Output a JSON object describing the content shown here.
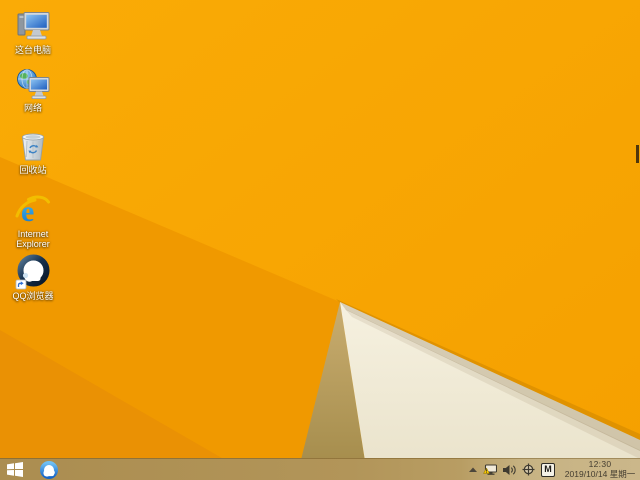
{
  "desktop": {
    "icons": [
      {
        "name": "this-pc",
        "label": "这台电脑"
      },
      {
        "name": "network",
        "label": "网络"
      },
      {
        "name": "recycle-bin",
        "label": "回收站"
      },
      {
        "name": "internet-explorer",
        "label": "Internet Explorer"
      },
      {
        "name": "qq-browser",
        "label": "QQ浏览器"
      }
    ]
  },
  "taskbar": {
    "pinned_apps": [
      {
        "name": "qq-browser"
      }
    ],
    "tray": {
      "icon_names": [
        "hidden-icons-arrow",
        "network-status",
        "volume",
        "crosshair",
        "ime-mode"
      ],
      "ime_letter": "M",
      "time": "12:30",
      "date": "2019/10/14 星期一"
    }
  },
  "colors": {
    "wallpaper_base": "#f8a601",
    "wallpaper_facet_mid": "#f09900",
    "wallpaper_facet_dark": "#ea9104",
    "wallpaper_tan": "#b79b5c",
    "wallpaper_cream": "#f4efdc",
    "taskbar": "#b29559",
    "tray_text": "#443d30",
    "warning_yellow": "#f6c800",
    "ie_blue": "#1e9ce0",
    "ie_gold": "#f2be00"
  }
}
